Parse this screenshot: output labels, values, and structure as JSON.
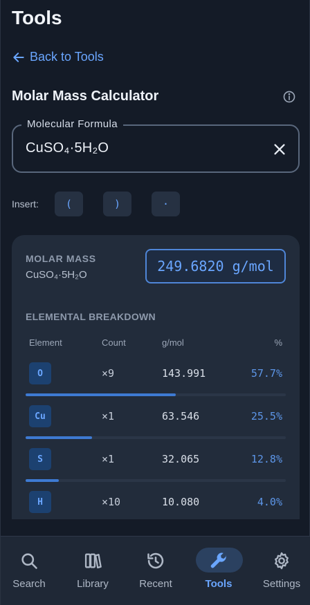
{
  "header": {
    "title": "Tools"
  },
  "back_link": {
    "label": "Back to Tools"
  },
  "calculator": {
    "title": "Molar Mass Calculator",
    "formula_field": {
      "label": "Molecular Formula",
      "value": "CuSO₄·5H₂O"
    }
  },
  "insert": {
    "label": "Insert:",
    "buttons": [
      "(",
      ")",
      "·"
    ]
  },
  "result": {
    "molar_mass_label": "MOLAR MASS",
    "formula": "CuSO₄·5H₂O",
    "value": "249.6820 g/mol"
  },
  "breakdown": {
    "title": "ELEMENTAL BREAKDOWN",
    "columns": {
      "element": "Element",
      "count": "Count",
      "gmol": "g/mol",
      "percent": "%"
    },
    "rows": [
      {
        "symbol": "O",
        "count": "×9",
        "gmol": "143.991",
        "percent": "57.7%",
        "fraction": 0.577
      },
      {
        "symbol": "Cu",
        "count": "×1",
        "gmol": "63.546",
        "percent": "25.5%",
        "fraction": 0.255
      },
      {
        "symbol": "S",
        "count": "×1",
        "gmol": "32.065",
        "percent": "12.8%",
        "fraction": 0.128
      },
      {
        "symbol": "H",
        "count": "×10",
        "gmol": "10.080",
        "percent": "4.0%",
        "fraction": 0.04
      }
    ]
  },
  "nav": {
    "items": [
      {
        "label": "Search",
        "icon": "search-icon",
        "active": false
      },
      {
        "label": "Library",
        "icon": "library-icon",
        "active": false
      },
      {
        "label": "Recent",
        "icon": "history-icon",
        "active": false
      },
      {
        "label": "Tools",
        "icon": "wrench-icon",
        "active": true
      },
      {
        "label": "Settings",
        "icon": "gear-icon",
        "active": false
      }
    ]
  },
  "colors": {
    "accent": "#6aa6ff",
    "background": "#141b27",
    "card": "#222c3b",
    "bar": "#3e7ad2"
  }
}
